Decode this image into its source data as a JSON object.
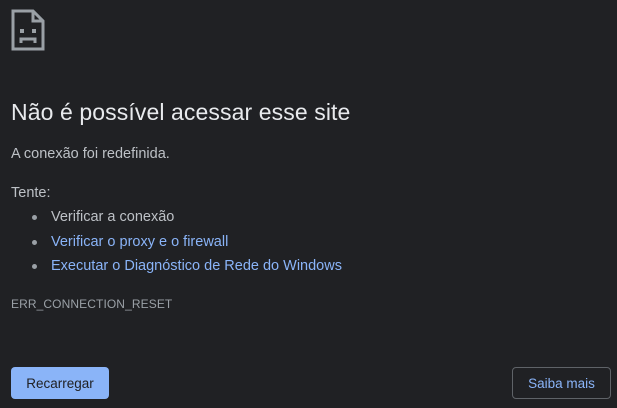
{
  "error_page": {
    "icon": "sad-page-icon",
    "heading": "Não é possível acessar esse site",
    "summary": "A conexão foi redefinida.",
    "try_label": "Tente:",
    "suggestions": [
      {
        "label": "Verificar a conexão",
        "is_link": false
      },
      {
        "label": "Verificar o proxy e o firewall",
        "is_link": true
      },
      {
        "label": "Executar o Diagnóstico de Rede do Windows",
        "is_link": true
      }
    ],
    "error_code": "ERR_CONNECTION_RESET"
  },
  "buttons": {
    "reload": "Recarregar",
    "details": "Saiba mais"
  },
  "colors": {
    "background": "#202124",
    "heading": "#e8eaed",
    "body_text": "#bdc1c6",
    "link": "#8ab4f8",
    "primary_button": "#8ab4f8",
    "secondary_border": "#5f6368"
  }
}
